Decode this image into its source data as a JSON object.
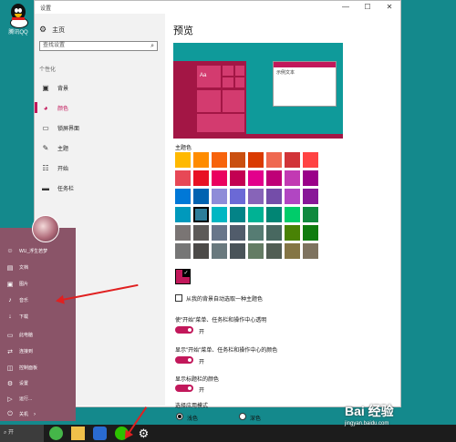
{
  "desktop": {
    "icon_label": "腾讯QQ"
  },
  "window": {
    "title": "设置",
    "minimize": "—",
    "maximize": "☐",
    "close": "✕"
  },
  "sidebar": {
    "home": "主页",
    "search_placeholder": "查找设置",
    "section": "个性化",
    "items": [
      {
        "label": "背景",
        "icon": "image-icon"
      },
      {
        "label": "颜色",
        "icon": "palette-icon",
        "active": true
      },
      {
        "label": "锁屏界面",
        "icon": "lock-screen-icon"
      },
      {
        "label": "主题",
        "icon": "theme-icon"
      },
      {
        "label": "开始",
        "icon": "start-icon"
      },
      {
        "label": "任务栏",
        "icon": "taskbar-icon"
      }
    ]
  },
  "content": {
    "preview_heading": "预览",
    "preview_tile_text": "Aa",
    "preview_window_text": "示例文本",
    "theme_color_label": "主题色",
    "swatch_colors": [
      [
        "#ffb900",
        "#ff8c00",
        "#f7630c",
        "#ca5010",
        "#da3b01",
        "#ef6950",
        "#d13438",
        "#ff4343"
      ],
      [
        "#e74856",
        "#e81123",
        "#ea005e",
        "#c30052",
        "#e3008c",
        "#bf0077",
        "#c239b3",
        "#9a0089"
      ],
      [
        "#0078d7",
        "#0063b1",
        "#8e8cd8",
        "#6b69d6",
        "#8764b8",
        "#744da9",
        "#b146c2",
        "#881798"
      ],
      [
        "#0099bc",
        "#2d7d9a",
        "#00b7c3",
        "#038387",
        "#00b294",
        "#018574",
        "#00cc6a",
        "#10893e"
      ],
      [
        "#7a7574",
        "#5d5a58",
        "#68768a",
        "#515c6b",
        "#567c73",
        "#486860",
        "#498205",
        "#107c10"
      ],
      [
        "#767676",
        "#4c4a48",
        "#69797e",
        "#4a5459",
        "#647c64",
        "#525e54",
        "#847545",
        "#7e735f"
      ]
    ],
    "selected_swatch": "#2d7d9a",
    "custom_color": "#c2185b",
    "auto_pick_label": "从我的背景自动选取一种主题色",
    "toggles": [
      {
        "label": "使\"开始\"菜单、任务栏和操作中心透明",
        "state": "开"
      },
      {
        "label": "显示\"开始\"菜单、任务栏和操作中心的颜色",
        "state": "开"
      },
      {
        "label": "显示标题栏的颜色",
        "state": "开"
      }
    ],
    "app_mode_label": "选择应用模式",
    "modes": [
      {
        "label": "浅色",
        "selected": true
      },
      {
        "label": "深色",
        "selected": false
      }
    ]
  },
  "start_menu": {
    "items": [
      {
        "label": "WU_浮生若梦",
        "icon": "user-icon"
      },
      {
        "label": "文档",
        "icon": "document-icon"
      },
      {
        "label": "图片",
        "icon": "picture-icon"
      },
      {
        "label": "音乐",
        "icon": "music-icon"
      },
      {
        "label": "下载",
        "icon": "download-icon"
      },
      {
        "label": "此电脑",
        "icon": "computer-icon"
      },
      {
        "label": "连接到",
        "icon": "connect-icon"
      },
      {
        "label": "控制面板",
        "icon": "control-panel-icon"
      },
      {
        "label": "设置",
        "icon": "gear-icon"
      },
      {
        "label": "运行...",
        "icon": "run-icon"
      },
      {
        "label": "关机",
        "icon": "power-icon"
      }
    ]
  },
  "taskbar": {
    "search_text": "⌕ 开"
  },
  "watermark": {
    "brand": "Bai 经验",
    "url": "jingyan.baidu.com"
  }
}
